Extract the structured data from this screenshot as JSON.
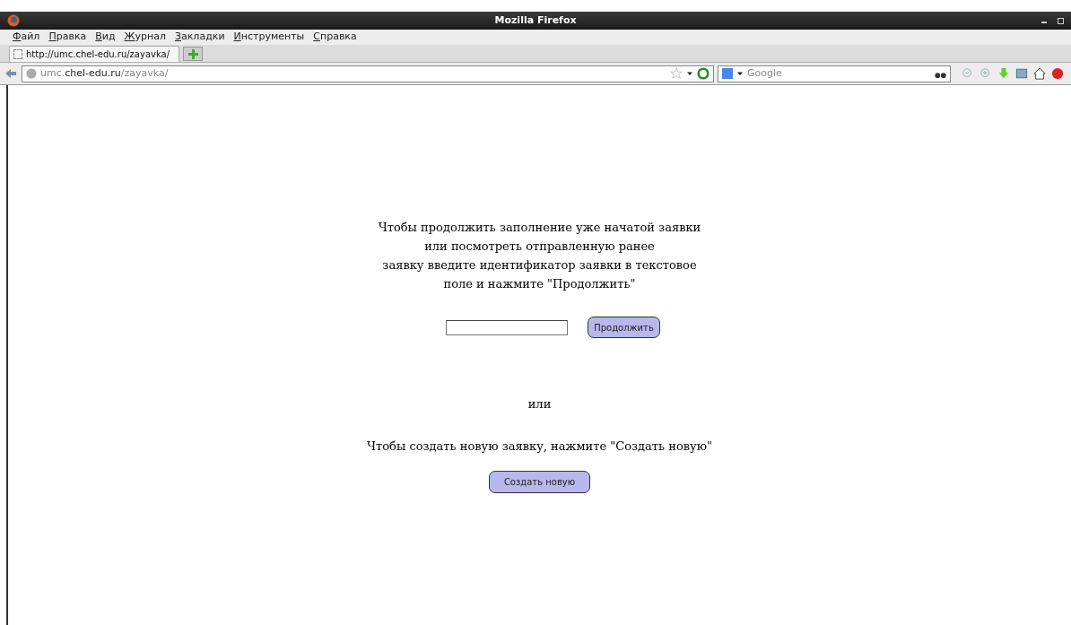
{
  "window": {
    "title": "Mozilla Firefox"
  },
  "menu": [
    "Файл",
    "Правка",
    "Вид",
    "Журнал",
    "Закладки",
    "Инструменты",
    "Справка"
  ],
  "tabs": [
    {
      "label": "http://umc.chel-edu.ru/zayavka/",
      "selected": true
    }
  ],
  "address_bar": {
    "url_parts": [
      {
        "text": "umc.",
        "kind": "dim"
      },
      {
        "text": "chel-edu.ru",
        "kind": "domain"
      },
      {
        "text": "/zayavka/",
        "kind": "dim"
      }
    ]
  },
  "search": {
    "placeholder": "Google"
  },
  "page": {
    "intro_lines": [
      "Чтобы продолжить заполнение уже начатой заявки",
      "или посмотреть отправленную ранее",
      "заявку введите идентификатор заявки в текстовое",
      "поле и нажмите \"Продолжить\""
    ],
    "continue_button": "Продолжить",
    "separator": "или",
    "create_text": "Чтобы создать новую заявку, нажмите \"Создать новую\"",
    "create_button": "Создать новую"
  }
}
